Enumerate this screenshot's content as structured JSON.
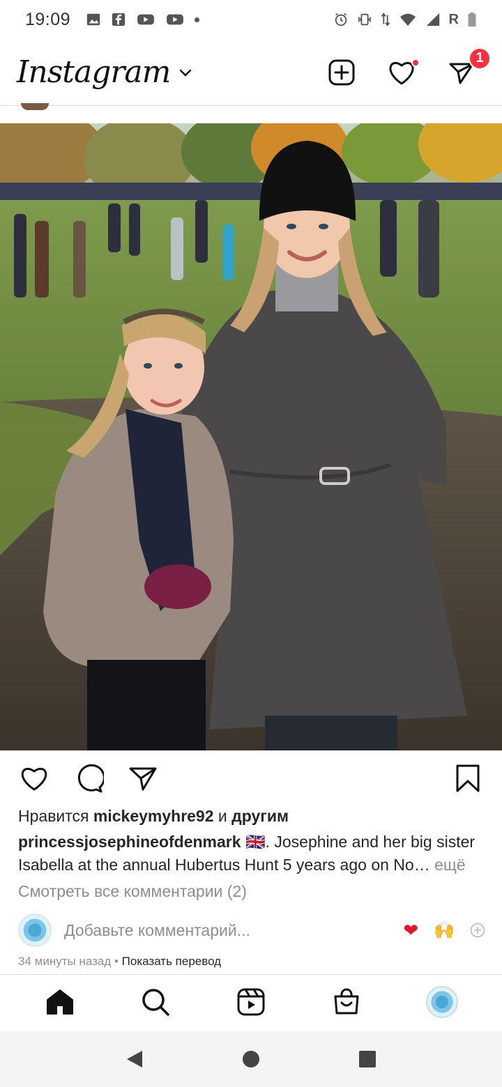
{
  "status_bar": {
    "time": "19:09",
    "network": "R",
    "left_icons": [
      "gallery-icon",
      "facebook-icon",
      "youtube-icon",
      "youtube-icon",
      "dot-icon"
    ],
    "right_icons": [
      "alarm-icon",
      "vibrate-icon",
      "data-arrows-icon",
      "wifi-icon",
      "signal-icon",
      "battery-icon"
    ]
  },
  "header": {
    "logo": "Instagram",
    "dm_badge": "1"
  },
  "post": {
    "likes_prefix": "Нравится",
    "likes_user": "mickeymyhre92",
    "likes_and": "и",
    "likes_others": "другим",
    "caption_user": "princessjosephineofdenmark",
    "caption_flag": "🇬🇧",
    "caption_text": ". Josephine and her big sister Isabella at the annual Hubertus Hunt 5 years ago on No…",
    "caption_more": "ещё",
    "view_comments": "Смотреть все комментарии (2)",
    "comment_placeholder": "Добавьте комментарий...",
    "emoji_heart": "❤",
    "emoji_hands": "🙌",
    "time_ago": "34 минуты назад",
    "meta_sep": " • ",
    "show_translation": "Показать перевод"
  },
  "bottom_nav": [
    "home-icon",
    "search-icon",
    "reels-icon",
    "shop-icon",
    "profile-avatar"
  ],
  "colors": {
    "accent_red": "#ff3040",
    "text": "#262626",
    "secondary": "#8e8e8e"
  }
}
